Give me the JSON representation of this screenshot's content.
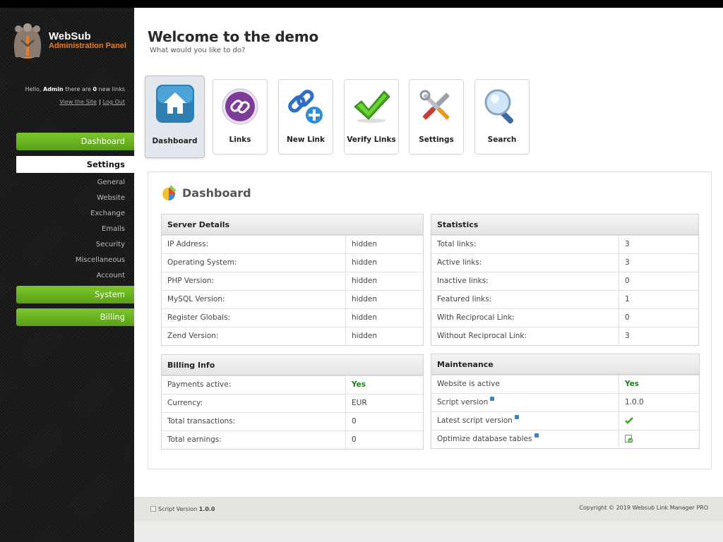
{
  "brand": {
    "name": "WebSub",
    "subtitle": "Administration Panel"
  },
  "user": {
    "greeting_prefix": "Hello,",
    "name": "Admin",
    "greeting_mid": "there are",
    "count": "0",
    "greeting_suffix": "new links",
    "view_site": "View the Site",
    "separator": "|",
    "logout": "Log Out"
  },
  "nav": {
    "dashboard": "Dashboard",
    "settings": "Settings",
    "settings_items": [
      "General",
      "Website",
      "Exchange",
      "Emails",
      "Security",
      "Miscellaneous",
      "Account"
    ],
    "system": "System",
    "billing": "Billing"
  },
  "header": {
    "title": "Welcome to the demo",
    "subtitle": "What would you like to do?"
  },
  "tiles": [
    {
      "label": "Dashboard",
      "icon": "home-icon"
    },
    {
      "label": "Links",
      "icon": "link-icon"
    },
    {
      "label": "New Link",
      "icon": "new-link-icon"
    },
    {
      "label": "Verify Links",
      "icon": "checkmark-icon"
    },
    {
      "label": "Settings",
      "icon": "tools-icon"
    },
    {
      "label": "Search",
      "icon": "magnifier-icon"
    }
  ],
  "panel": {
    "title": "Dashboard"
  },
  "server": {
    "title": "Server Details",
    "rows": [
      {
        "k": "IP Address:",
        "v": "hidden"
      },
      {
        "k": "Operating System:",
        "v": "hidden"
      },
      {
        "k": "PHP Version:",
        "v": "hidden"
      },
      {
        "k": "MySQL Version:",
        "v": "hidden"
      },
      {
        "k": "Register Globals:",
        "v": "hidden"
      },
      {
        "k": "Zend Version:",
        "v": "hidden"
      }
    ]
  },
  "stats": {
    "title": "Statistics",
    "rows": [
      {
        "k": "Total links:",
        "v": "3"
      },
      {
        "k": "Active links:",
        "v": "3"
      },
      {
        "k": "Inactive links:",
        "v": "0"
      },
      {
        "k": "Featured links:",
        "v": "1"
      },
      {
        "k": "With Reciprocal Link:",
        "v": "0"
      },
      {
        "k": "Without Reciprocal Link:",
        "v": "3"
      }
    ]
  },
  "billing": {
    "title": "Billing Info",
    "rows": [
      {
        "k": "Payments active:",
        "v": "Yes"
      },
      {
        "k": "Currency:",
        "v": "EUR"
      },
      {
        "k": "Total transactions:",
        "v": "0"
      },
      {
        "k": "Total earnings:",
        "v": "0"
      }
    ]
  },
  "maintenance": {
    "title": "Maintenance",
    "rows": [
      {
        "k": "Website is active",
        "v": "Yes"
      },
      {
        "k": "Script version",
        "v": "1.0.0"
      },
      {
        "k": "Latest script version",
        "v": ""
      },
      {
        "k": "Optimize database tables",
        "v": ""
      }
    ]
  },
  "footer": {
    "script_version_label": "Script Version",
    "script_version": "1.0.0",
    "copyright": "Copyright © 2019 Websub Link Manager PRO"
  },
  "colors": {
    "accent_green": "#6db524",
    "logo_orange": "#f07d1c",
    "yes_green": "#1a7d1a"
  }
}
